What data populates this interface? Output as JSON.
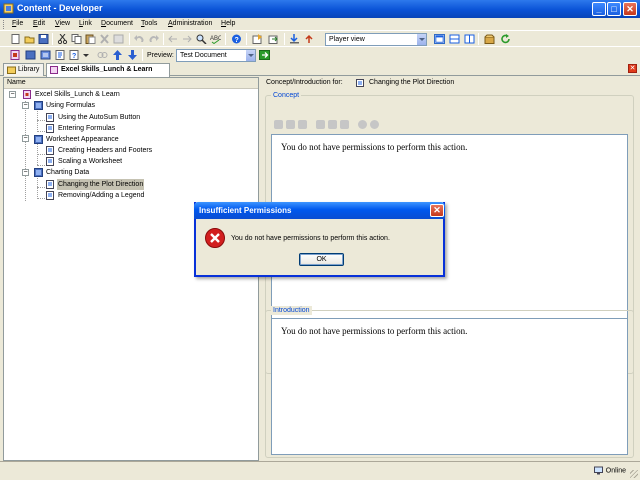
{
  "window": {
    "title": "Content - Developer",
    "min_symbol": "_",
    "max_symbol": "□",
    "close_symbol": "✕"
  },
  "menubar": {
    "items": [
      {
        "accel": "F",
        "rest": "ile"
      },
      {
        "accel": "E",
        "rest": "dit"
      },
      {
        "accel": "V",
        "rest": "iew"
      },
      {
        "accel": "L",
        "rest": "ink"
      },
      {
        "accel": "D",
        "rest": "ocument"
      },
      {
        "accel": "T",
        "rest": "ools"
      },
      {
        "accel": "A",
        "rest": "dministration"
      },
      {
        "accel": "H",
        "rest": "elp"
      }
    ]
  },
  "toolbar": {
    "view_mode": "Player view",
    "preview_label": "Preview:",
    "preview_value": "Test Document"
  },
  "tabs": [
    {
      "label": "Library"
    },
    {
      "label": "Excel Skills_Lunch & Learn",
      "close": "✕"
    }
  ],
  "panel_close": "✕",
  "outline": {
    "column_header": "Name",
    "expander_minus": "−",
    "items": [
      {
        "label": "Excel Skills_Lunch & Learn"
      },
      {
        "label": "Using Formulas"
      },
      {
        "label": "Using the AutoSum Button"
      },
      {
        "label": "Entering Formulas"
      },
      {
        "label": "Worksheet Appearance"
      },
      {
        "label": "Creating Headers and Footers"
      },
      {
        "label": "Scaling a Worksheet"
      },
      {
        "label": "Charting Data"
      },
      {
        "label": "Changing the Plot Direction"
      },
      {
        "label": "Removing/Adding a Legend"
      }
    ]
  },
  "content": {
    "header_prefix": "Concept/Introduction for:",
    "header_topic": "Changing the Plot Direction",
    "concept": {
      "legend": "Concept",
      "text": "You do not have permissions to perform this action."
    },
    "introduction": {
      "legend": "Introduction",
      "text": "You do not have permissions to perform this action."
    }
  },
  "dialog": {
    "title": "Insufficient Permissions",
    "message": "You do not have permissions to perform this action.",
    "ok_label": "OK",
    "close_symbol": "✕"
  },
  "status": {
    "online": "Online"
  },
  "colors": {
    "title_blue": "#0a52d6",
    "error_red": "#d21f1f",
    "legend_blue": "#0046d5"
  }
}
